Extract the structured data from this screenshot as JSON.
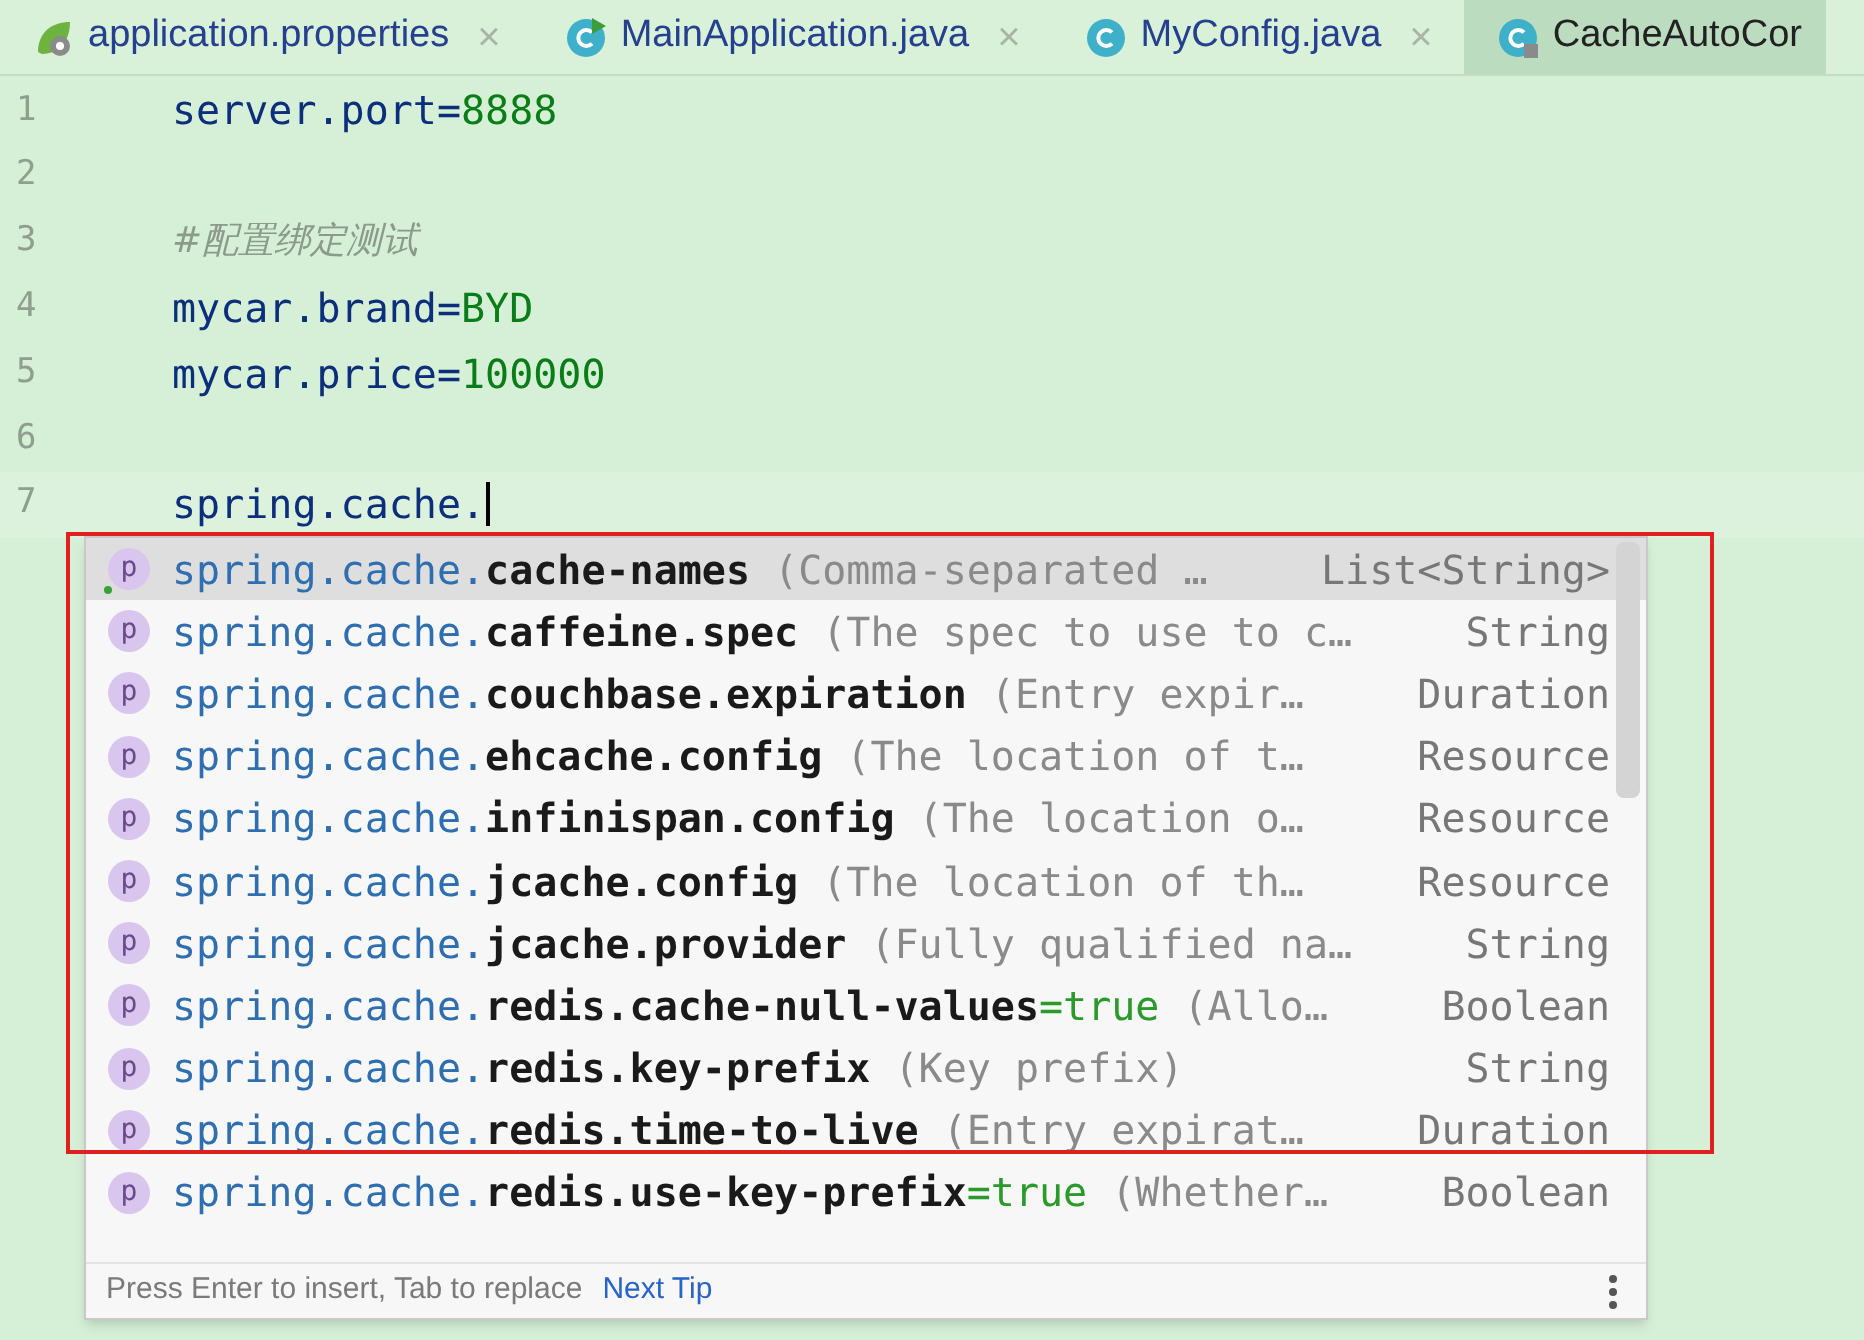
{
  "tabs": [
    {
      "label": "application.properties",
      "kind": "spring",
      "selected": false,
      "closable": true
    },
    {
      "label": "MainApplication.java",
      "kind": "class-run",
      "selected": false,
      "closable": true
    },
    {
      "label": "MyConfig.java",
      "kind": "class",
      "selected": false,
      "closable": true
    },
    {
      "label": "CacheAutoCor",
      "kind": "class-locked",
      "selected": true,
      "closable": false
    }
  ],
  "close_glyph": "×",
  "editor": {
    "lines": [
      {
        "number": "1",
        "kind": "property",
        "key": "server.port",
        "separator": "=",
        "value": "8888"
      },
      {
        "number": "2",
        "kind": "blank"
      },
      {
        "number": "3",
        "kind": "comment",
        "text": "#配置绑定测试"
      },
      {
        "number": "4",
        "kind": "property",
        "key": "mycar.brand",
        "separator": "=",
        "value": "BYD"
      },
      {
        "number": "5",
        "kind": "property",
        "key": "mycar.price",
        "separator": "=",
        "value": "100000"
      },
      {
        "number": "6",
        "kind": "blank"
      },
      {
        "number": "7",
        "kind": "typing",
        "text": "spring.cache.",
        "current": true
      }
    ]
  },
  "completion": {
    "items": [
      {
        "icon": "p",
        "prefix": "spring.cache.",
        "name": "cache-names",
        "description": "(Comma-separated …",
        "type": "List<String>",
        "selected": true
      },
      {
        "icon": "p",
        "prefix": "spring.cache.",
        "name": "caffeine.spec",
        "description": "(The spec to use to c…",
        "type": "String",
        "selected": false
      },
      {
        "icon": "p",
        "prefix": "spring.cache.",
        "name": "couchbase.expiration",
        "description": "(Entry expir…",
        "type": "Duration",
        "selected": false
      },
      {
        "icon": "p",
        "prefix": "spring.cache.",
        "name": "ehcache.config",
        "description": "(The location of t…",
        "type": "Resource",
        "selected": false
      },
      {
        "icon": "p",
        "prefix": "spring.cache.",
        "name": "infinispan.config",
        "description": "(The location o…",
        "type": "Resource",
        "selected": false
      },
      {
        "icon": "p",
        "prefix": "spring.cache.",
        "name": "jcache.config",
        "description": "(The location of th…",
        "type": "Resource",
        "selected": false
      },
      {
        "icon": "p",
        "prefix": "spring.cache.",
        "name": "jcache.provider",
        "description": "(Fully qualified na…",
        "type": "String",
        "selected": false
      },
      {
        "icon": "p",
        "prefix": "spring.cache.",
        "name": "redis.cache-null-values",
        "value": "=true",
        "description": "(Allo…",
        "type": "Boolean",
        "selected": false
      },
      {
        "icon": "p",
        "prefix": "spring.cache.",
        "name": "redis.key-prefix",
        "description": "(Key prefix)",
        "type": "String",
        "selected": false
      },
      {
        "icon": "p",
        "prefix": "spring.cache.",
        "name": "redis.time-to-live",
        "description": "(Entry expirat…",
        "type": "Duration",
        "selected": false
      },
      {
        "icon": "p",
        "prefix": "spring.cache.",
        "name": "redis.use-key-prefix",
        "value": "=true",
        "description": "(Whether…",
        "type": "Boolean",
        "selected": false
      }
    ],
    "hint": "Press Enter to insert, Tab to replace",
    "hint_link": "Next Tip"
  }
}
